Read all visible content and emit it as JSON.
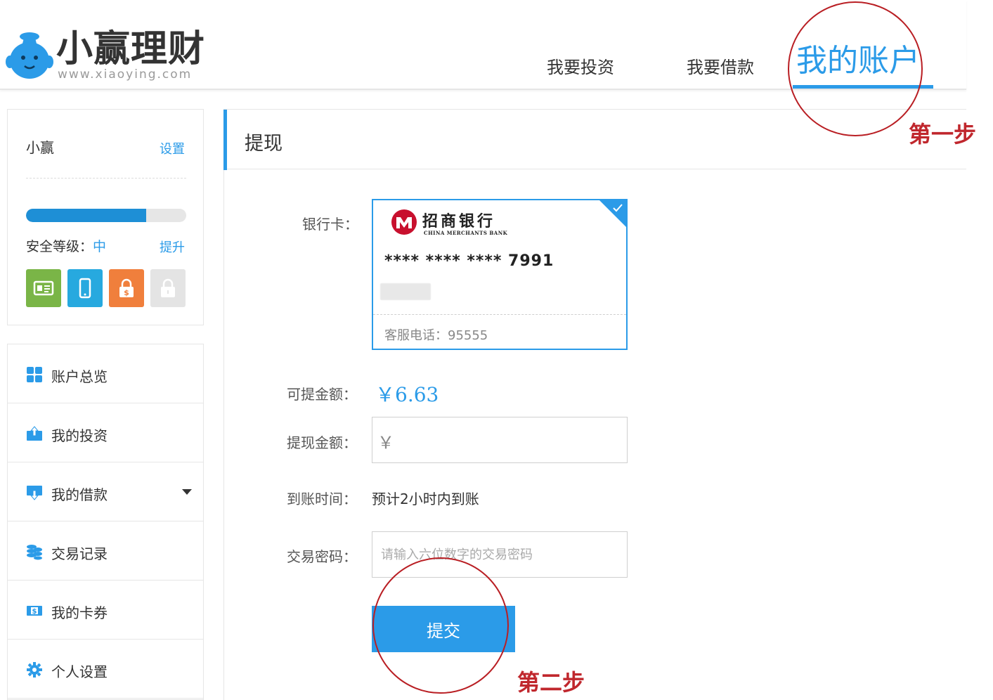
{
  "brand": {
    "name": "小赢理财",
    "url": "www.xiaoying.com",
    "accent_color": "#2b9be8"
  },
  "nav": {
    "items": [
      {
        "label": "我要投资"
      },
      {
        "label": "我要借款"
      },
      {
        "label": "我的账户",
        "active": true
      }
    ]
  },
  "sidebar": {
    "user_name": "小赢",
    "settings_label": "设置",
    "security": {
      "label": "安全等级：",
      "level": "中",
      "upgrade_label": "提升",
      "progress": 0.75,
      "icons": [
        {
          "name": "id-card-icon",
          "color": "#7ab547"
        },
        {
          "name": "phone-icon",
          "color": "#27a9df"
        },
        {
          "name": "dollar-lock-icon",
          "color": "#f07f3c"
        },
        {
          "name": "lock-icon",
          "color": "#e4e4e4"
        }
      ]
    },
    "menu": [
      {
        "label": "账户总览",
        "icon": "grid-icon"
      },
      {
        "label": "我的投资",
        "icon": "invest-icon"
      },
      {
        "label": "我的借款",
        "icon": "loan-icon",
        "expandable": true
      },
      {
        "label": "交易记录",
        "icon": "coins-icon"
      },
      {
        "label": "我的卡券",
        "icon": "voucher-icon"
      },
      {
        "label": "个人设置",
        "icon": "gear-icon"
      }
    ]
  },
  "main": {
    "title": "提现",
    "form": {
      "bank_card_label": "银行卡：",
      "bank_card": {
        "bank_name": "招商银行",
        "bank_name_en": "CHINA MERCHANTS BANK",
        "number": "**** **** **** 7991",
        "hotline": "客服电话：95555"
      },
      "available_label": "可提金额：",
      "available_amount": "￥6.63",
      "withdraw_label": "提现金额：",
      "withdraw_prefix": "￥",
      "withdraw_value": "",
      "arrival_label": "到账时间：",
      "arrival_value": "预计2小时内到账",
      "password_label": "交易密码：",
      "password_placeholder": "请输入六位数字的交易密码",
      "submit_label": "提交"
    }
  },
  "annotations": {
    "step1": "第一步",
    "step2": "第二步",
    "color": "#c0272d"
  }
}
